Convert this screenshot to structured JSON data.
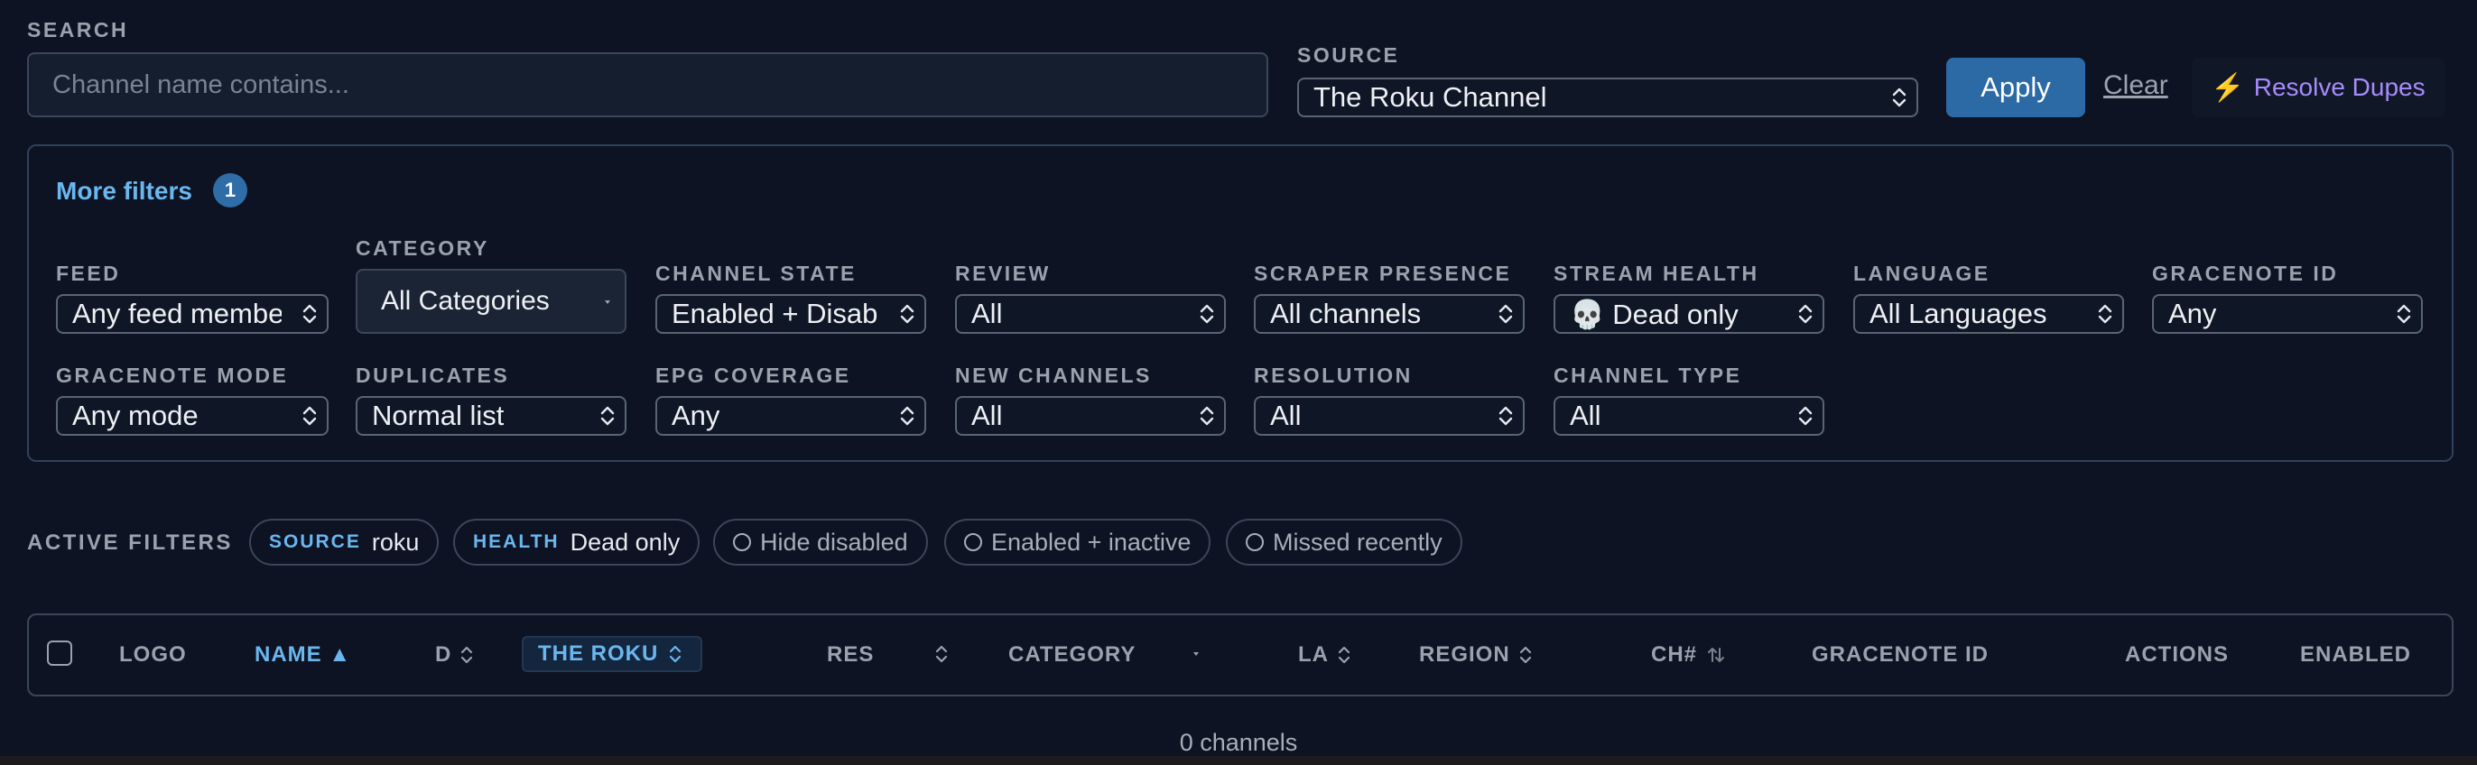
{
  "search": {
    "label": "SEARCH",
    "placeholder": "Channel name contains..."
  },
  "source": {
    "label": "SOURCE",
    "value": "The Roku Channel"
  },
  "buttons": {
    "apply": "Apply",
    "clear": "Clear",
    "resolve_icon": "⚡",
    "resolve": "Resolve Dupes"
  },
  "more_filters": {
    "label": "More filters",
    "count": "1"
  },
  "filters": {
    "feed": {
      "label": "FEED",
      "value": "Any feed member"
    },
    "category": {
      "label": "CATEGORY",
      "value": "All Categories"
    },
    "channel_state": {
      "label": "CHANNEL STATE",
      "value": "Enabled + Disabled"
    },
    "review": {
      "label": "REVIEW",
      "value": "All"
    },
    "scraper_presence": {
      "label": "SCRAPER PRESENCE",
      "value": "All channels"
    },
    "stream_health": {
      "label": "STREAM HEALTH",
      "value": "💀 Dead only"
    },
    "language": {
      "label": "LANGUAGE",
      "value": "All Languages"
    },
    "gracenote_id": {
      "label": "GRACENOTE ID",
      "value": "Any"
    },
    "gracenote_mode": {
      "label": "GRACENOTE MODE",
      "value": "Any mode"
    },
    "duplicates": {
      "label": "DUPLICATES",
      "value": "Normal list"
    },
    "epg_coverage": {
      "label": "EPG COVERAGE",
      "value": "Any"
    },
    "new_channels": {
      "label": "NEW CHANNELS",
      "value": "All"
    },
    "resolution": {
      "label": "RESOLUTION",
      "value": "All"
    },
    "channel_type": {
      "label": "CHANNEL TYPE",
      "value": "All"
    }
  },
  "active_filters": {
    "label": "ACTIVE FILTERS",
    "chips": [
      {
        "key": "SOURCE",
        "value": "roku"
      },
      {
        "key": "HEALTH",
        "value": "Dead only"
      }
    ],
    "toggles": [
      "Hide disabled",
      "Enabled + inactive",
      "Missed recently"
    ]
  },
  "table": {
    "columns": {
      "logo": "LOGO",
      "name": "NAME ▲",
      "d": "D",
      "provider": "THE ROKU",
      "res": "RES",
      "category": "CATEGORY",
      "la": "LA",
      "region": "REGION",
      "ch": "CH#",
      "gracenote_id": "GRACENOTE ID",
      "actions": "ACTIONS",
      "enabled": "ENABLED"
    },
    "count_text": "0 channels"
  },
  "colors": {
    "background": "#0d1322",
    "accent": "#6ab7f0",
    "apply": "#2c6aa6",
    "resolve": "#a78bfa"
  }
}
